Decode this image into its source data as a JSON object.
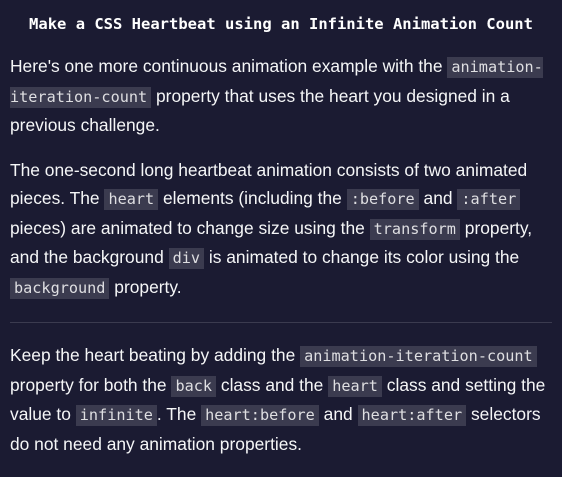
{
  "title": "Make a CSS Heartbeat using an Infinite Animation Count",
  "paragraph1": {
    "t1": "Here's one more continuous animation example with the",
    "c1": "animation-iteration-count",
    "t2": "property that uses the heart you designed in a previous challenge."
  },
  "paragraph2": {
    "t1": "The one-second long heartbeat animation consists of two animated pieces. The",
    "c1": "heart",
    "t2": "elements (including the",
    "c2": ":before",
    "t3": "and",
    "c3": ":after",
    "t4": "pieces) are animated to change size using the",
    "c4": "transform",
    "t5": "property, and the background",
    "c5": "div",
    "t6": "is animated to change its color using the",
    "c6": "background",
    "t7": "property."
  },
  "instructions": {
    "t1": "Keep the heart beating by adding the",
    "c1": "animation-iteration-count",
    "t2": "property for both the",
    "c2": "back",
    "t3": "class and the",
    "c3": "heart",
    "t4": "class and setting the value to",
    "c4": "infinite",
    "t5": ". The",
    "c5": "heart:before",
    "t6": "and",
    "c6": "heart:after",
    "t7": "selectors do not need any animation properties."
  }
}
